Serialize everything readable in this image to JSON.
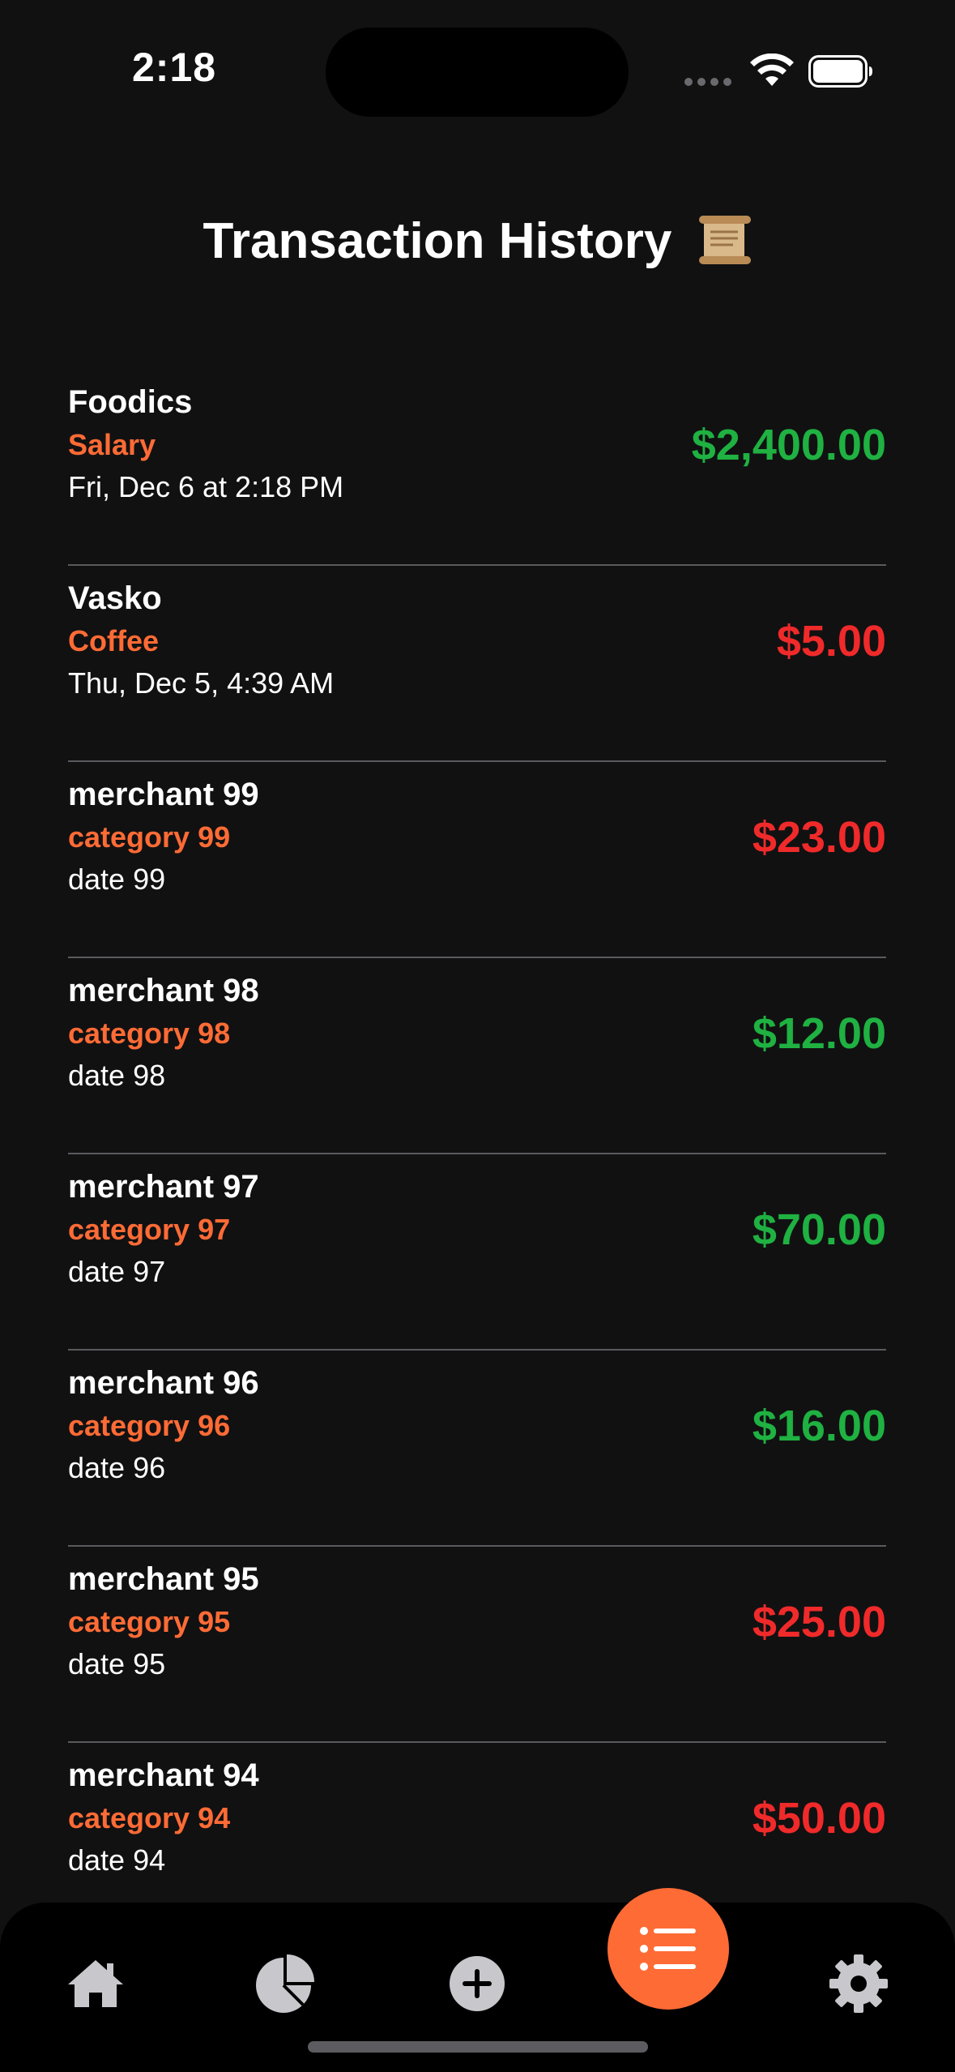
{
  "status_bar": {
    "time": "2:18"
  },
  "header": {
    "title": "Transaction History",
    "title_icon": "scroll-icon"
  },
  "transactions": [
    {
      "merchant": "Foodics",
      "category": "Salary",
      "date": "Fri, Dec 6 at 2:18 PM",
      "amount": "$2,400.00",
      "type": "income"
    },
    {
      "merchant": "Vasko",
      "category": "Coffee",
      "date": "Thu, Dec 5, 4:39 AM",
      "amount": "$5.00",
      "type": "expense"
    },
    {
      "merchant": "merchant 99",
      "category": "category 99",
      "date": "date 99",
      "amount": "$23.00",
      "type": "expense"
    },
    {
      "merchant": "merchant 98",
      "category": "category 98",
      "date": "date 98",
      "amount": "$12.00",
      "type": "income"
    },
    {
      "merchant": "merchant 97",
      "category": "category 97",
      "date": "date 97",
      "amount": "$70.00",
      "type": "income"
    },
    {
      "merchant": "merchant 96",
      "category": "category 96",
      "date": "date 96",
      "amount": "$16.00",
      "type": "income"
    },
    {
      "merchant": "merchant 95",
      "category": "category 95",
      "date": "date 95",
      "amount": "$25.00",
      "type": "expense"
    },
    {
      "merchant": "merchant 94",
      "category": "category 94",
      "date": "date 94",
      "amount": "$50.00",
      "type": "expense"
    }
  ],
  "tab_bar": {
    "tabs": [
      {
        "icon": "house-icon",
        "active": false
      },
      {
        "icon": "pie-chart-icon",
        "active": false
      },
      {
        "icon": "plus-circle-icon",
        "active": false
      },
      {
        "icon": "list-icon",
        "active": true
      },
      {
        "icon": "gear-icon",
        "active": false
      }
    ]
  },
  "colors": {
    "background": "#111112",
    "accent": "#ff6b35",
    "income": "#1fb141",
    "expense": "#f02a2a",
    "divider": "#5a5a5e"
  }
}
